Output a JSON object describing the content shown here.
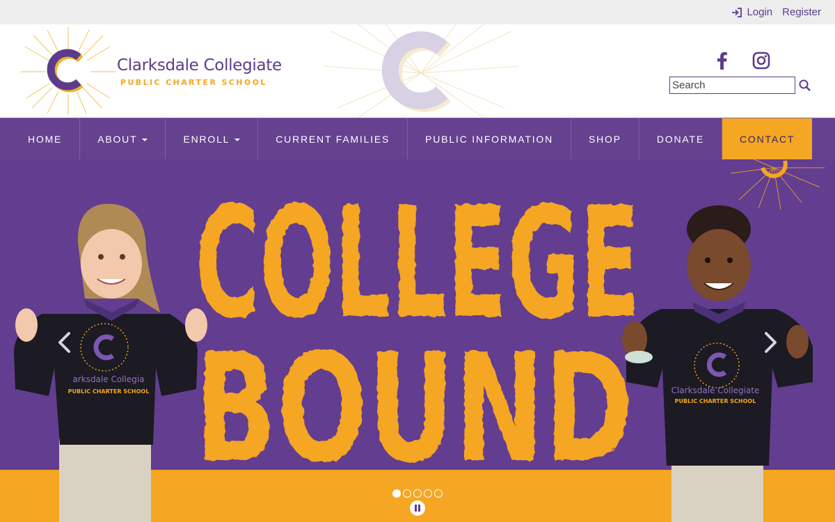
{
  "topbar": {
    "login_label": "Login",
    "register_label": "Register"
  },
  "logo": {
    "name": "Clarksdale Collegiate",
    "subtitle": "PUBLIC CHARTER SCHOOL"
  },
  "social": {
    "facebook_icon": "facebook-icon",
    "instagram_icon": "instagram-icon"
  },
  "search": {
    "placeholder": "Search"
  },
  "nav": {
    "items": [
      {
        "label": "HOME"
      },
      {
        "label": "ABOUT"
      },
      {
        "label": "ENROLL"
      },
      {
        "label": "CURRENT FAMILIES"
      },
      {
        "label": "PUBLIC INFORMATION"
      },
      {
        "label": "SHOP"
      },
      {
        "label": "DONATE"
      },
      {
        "label": "CONTACT"
      }
    ]
  },
  "hero": {
    "headline_line1": "COLLEGE",
    "headline_line2": "BOUND",
    "sweatshirt_brand": "Clarksdale Collegiate",
    "sweatshirt_sub": "PUBLIC CHARTER SCHOOL",
    "sweatshirt_brand_cropped": "arksdale Collegia",
    "slide_count": 5,
    "active_slide": 1
  },
  "colors": {
    "brand_purple": "#5c3c8a",
    "nav_purple": "#66418f",
    "hero_purple": "#5e3a8a",
    "brand_orange": "#f5a623",
    "topbar_gray": "#ededed"
  }
}
